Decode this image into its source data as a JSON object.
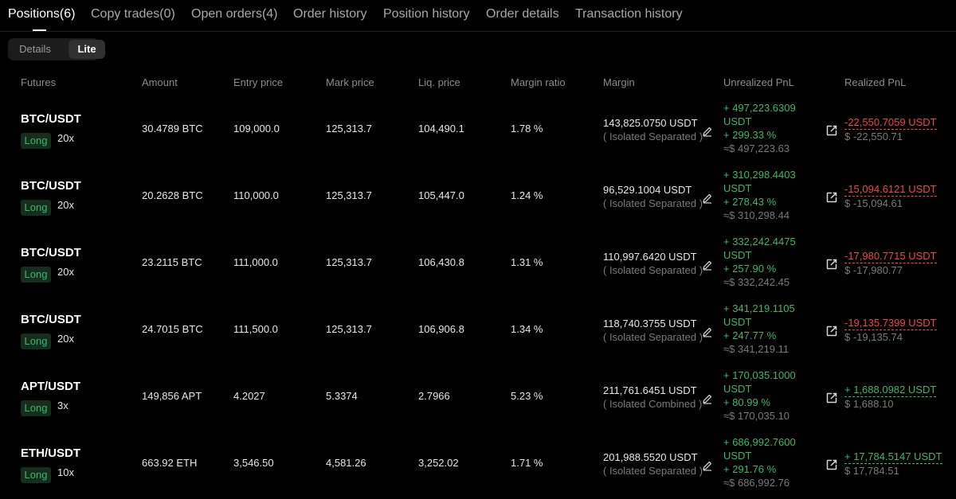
{
  "tabs": [
    {
      "label": "Positions(6)",
      "active": true
    },
    {
      "label": "Copy trades(0)"
    },
    {
      "label": "Open orders(4)"
    },
    {
      "label": "Order history"
    },
    {
      "label": "Position history"
    },
    {
      "label": "Order details"
    },
    {
      "label": "Transaction history"
    }
  ],
  "view_mode": {
    "options": [
      "Details",
      "Lite"
    ],
    "selected": "Lite"
  },
  "columns": {
    "futures": "Futures",
    "amount": "Amount",
    "entry": "Entry price",
    "mark": "Mark price",
    "liq": "Liq. price",
    "ratio": "Margin ratio",
    "margin": "Margin",
    "upnl": "Unrealized PnL",
    "rpnl": "Realized PnL"
  },
  "colors": {
    "profit": "#39b968",
    "loss": "#f0454a",
    "long_bg": "#152e1f",
    "muted": "#7a7a7a"
  },
  "icons": {
    "edit": "pencil-icon",
    "share": "share-icon"
  },
  "positions": [
    {
      "symbol": "BTC/USDT",
      "side": "Long",
      "leverage": "20x",
      "amount": "30.4789 BTC",
      "entry": "109,000.0",
      "mark": "125,313.7",
      "liq": "104,490.1",
      "ratio": "1.78 %",
      "margin": "143,825.0750 USDT",
      "margin_mode": "( Isolated Separated )",
      "upnl": "+ 497,223.6309",
      "upnl_unit": "USDT",
      "upnl_pct": "+ 299.33 %",
      "upnl_usd": "≈$ 497,223.63",
      "rpnl": "-22,550.7059 USDT",
      "rpnl_usd": "$ -22,550.71",
      "rpnl_sign": "loss"
    },
    {
      "symbol": "BTC/USDT",
      "side": "Long",
      "leverage": "20x",
      "amount": "20.2628 BTC",
      "entry": "110,000.0",
      "mark": "125,313.7",
      "liq": "105,447.0",
      "ratio": "1.24 %",
      "margin": "96,529.1004 USDT",
      "margin_mode": "( Isolated Separated )",
      "upnl": "+ 310,298.4403",
      "upnl_unit": "USDT",
      "upnl_pct": "+ 278.43 %",
      "upnl_usd": "≈$ 310,298.44",
      "rpnl": "-15,094.6121 USDT",
      "rpnl_usd": "$ -15,094.61",
      "rpnl_sign": "loss"
    },
    {
      "symbol": "BTC/USDT",
      "side": "Long",
      "leverage": "20x",
      "amount": "23.2115 BTC",
      "entry": "111,000.0",
      "mark": "125,313.7",
      "liq": "106,430.8",
      "ratio": "1.31 %",
      "margin": "110,997.6420 USDT",
      "margin_mode": "( Isolated Separated )",
      "upnl": "+ 332,242.4475",
      "upnl_unit": "USDT",
      "upnl_pct": "+ 257.90 %",
      "upnl_usd": "≈$ 332,242.45",
      "rpnl": "-17,980.7715 USDT",
      "rpnl_usd": "$ -17,980.77",
      "rpnl_sign": "loss"
    },
    {
      "symbol": "BTC/USDT",
      "side": "Long",
      "leverage": "20x",
      "amount": "24.7015 BTC",
      "entry": "111,500.0",
      "mark": "125,313.7",
      "liq": "106,906.8",
      "ratio": "1.34 %",
      "margin": "118,740.3755 USDT",
      "margin_mode": "( Isolated Separated )",
      "upnl": "+ 341,219.1105",
      "upnl_unit": "USDT",
      "upnl_pct": "+ 247.77 %",
      "upnl_usd": "≈$ 341,219.11",
      "rpnl": "-19,135.7399 USDT",
      "rpnl_usd": "$ -19,135.74",
      "rpnl_sign": "loss"
    },
    {
      "symbol": "APT/USDT",
      "side": "Long",
      "leverage": "3x",
      "amount": "149,856 APT",
      "entry": "4.2027",
      "mark": "5.3374",
      "liq": "2.7966",
      "ratio": "5.23 %",
      "margin": "211,761.6451 USDT",
      "margin_mode": "( Isolated Combined )",
      "upnl": "+ 170,035.1000",
      "upnl_unit": "USDT",
      "upnl_pct": "+ 80.99 %",
      "upnl_usd": "≈$ 170,035.10",
      "rpnl": "+ 1,688.0982 USDT",
      "rpnl_usd": "$ 1,688.10",
      "rpnl_sign": "profit"
    },
    {
      "symbol": "ETH/USDT",
      "side": "Long",
      "leverage": "10x",
      "amount": "663.92 ETH",
      "entry": "3,546.50",
      "mark": "4,581.26",
      "liq": "3,252.02",
      "ratio": "1.71 %",
      "margin": "201,988.5520 USDT",
      "margin_mode": "( Isolated Separated )",
      "upnl": "+ 686,992.7600",
      "upnl_unit": "USDT",
      "upnl_pct": "+ 291.76 %",
      "upnl_usd": "≈$ 686,992.76",
      "rpnl": "+ 17,784.5147 USDT",
      "rpnl_usd": "$ 17,784.51",
      "rpnl_sign": "profit"
    }
  ]
}
